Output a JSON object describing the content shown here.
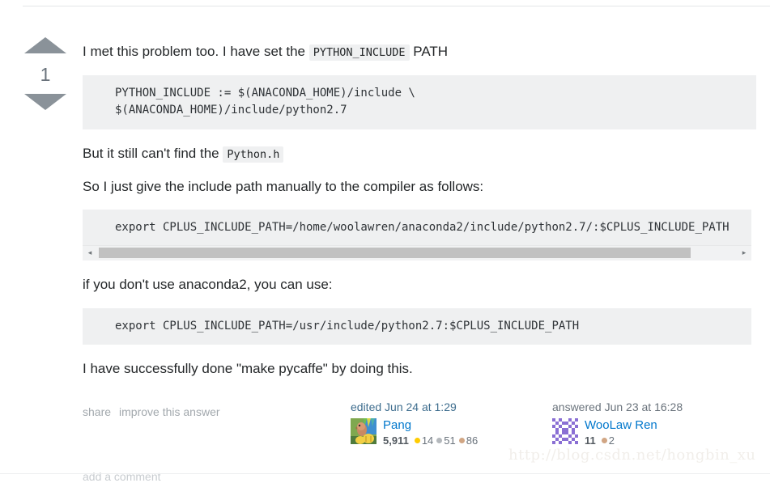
{
  "post": {
    "vote_score": "1",
    "paragraph_1_pre": "I met this problem too. I have set the",
    "paragraph_1_code": "PYTHON_INCLUDE",
    "paragraph_1_post": "PATH",
    "code_block_1": "PYTHON_INCLUDE := $(ANACONDA_HOME)/include \\\n$(ANACONDA_HOME)/include/python2.7",
    "paragraph_2_pre": "But it still can't find the",
    "paragraph_2_code": "Python.h",
    "paragraph_3": "So I just give the include path manually to the compiler as follows:",
    "code_block_2": "export CPLUS_INCLUDE_PATH=/home/woolawren/anaconda2/include/python2.7/:$CPLUS_INCLUDE_PATH",
    "paragraph_4": "if you don't use anaconda2, you can use:",
    "code_block_3": "export CPLUS_INCLUDE_PATH=/usr/include/python2.7:$CPLUS_INCLUDE_PATH",
    "paragraph_5": "I have successfully done \"make pycaffe\" by doing this."
  },
  "actions": {
    "share": "share",
    "improve": "improve this answer",
    "add_comment": "add a comment"
  },
  "editor": {
    "action_time": "edited Jun 24 at 1:29",
    "username": "Pang",
    "reputation": "5,911",
    "badges": [
      {
        "count": "14",
        "class": "gold"
      },
      {
        "count": "51",
        "class": "silver"
      },
      {
        "count": "86",
        "class": "bronze"
      }
    ]
  },
  "answerer": {
    "action_time": "answered Jun 23 at 16:28",
    "username": "WooLaw Ren",
    "reputation": "11",
    "badges": [
      {
        "count": "2",
        "class": "bronze"
      }
    ]
  },
  "scrollbar": {
    "left_arrow": "◂",
    "right_arrow": "▸"
  },
  "watermark": {
    "text": "http://blog.csdn.net/hongbin_xu"
  },
  "colors": {
    "link": "#0077cc",
    "meta_link": "#3e6d8e",
    "code_bg": "#eff0f1",
    "vote_arrow": "#8a9299",
    "gold": "#ffcc01",
    "silver": "#b4b8bc",
    "bronze": "#d1a684"
  }
}
